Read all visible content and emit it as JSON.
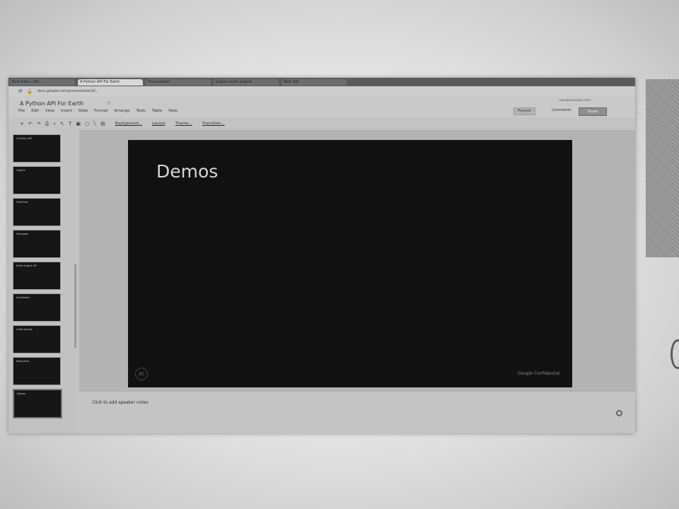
{
  "browser": {
    "tabs": [
      {
        "label": "Bolt-Adam - Ma...",
        "active": false
      },
      {
        "label": "A Python API For Earth",
        "active": true
      },
      {
        "label": "Presentation",
        "active": false
      },
      {
        "label": "python earth engine",
        "active": false
      },
      {
        "label": "New Tab",
        "active": false
      }
    ],
    "address": "docs.google.com/presentation/d/..."
  },
  "app": {
    "title": "A Python API For Earth",
    "menu": [
      "File",
      "Edit",
      "View",
      "Insert",
      "Slide",
      "Format",
      "Arrange",
      "Tools",
      "Table",
      "Help"
    ],
    "user": "user@example.com",
    "present_label": "Present",
    "comments_label": "Comments",
    "share_label": "Share"
  },
  "toolbar": {
    "background_label": "Background...",
    "layout_label": "Layout",
    "theme_label": "Theme...",
    "transition_label": "Transition..."
  },
  "filmstrip": {
    "slides": [
      {
        "title": "A Python API"
      },
      {
        "title": "Outline"
      },
      {
        "title": "Overview"
      },
      {
        "title": "Examples"
      },
      {
        "title": "Earth Engine API"
      },
      {
        "title": "Installation"
      },
      {
        "title": "Code sample"
      },
      {
        "title": "Resources"
      },
      {
        "title": "Demos"
      }
    ],
    "selected_index": 8
  },
  "slide": {
    "title": "Demos",
    "logo_text": "EE",
    "footer": "Google Confidential"
  },
  "notes": {
    "placeholder": "Click to add speaker notes"
  }
}
